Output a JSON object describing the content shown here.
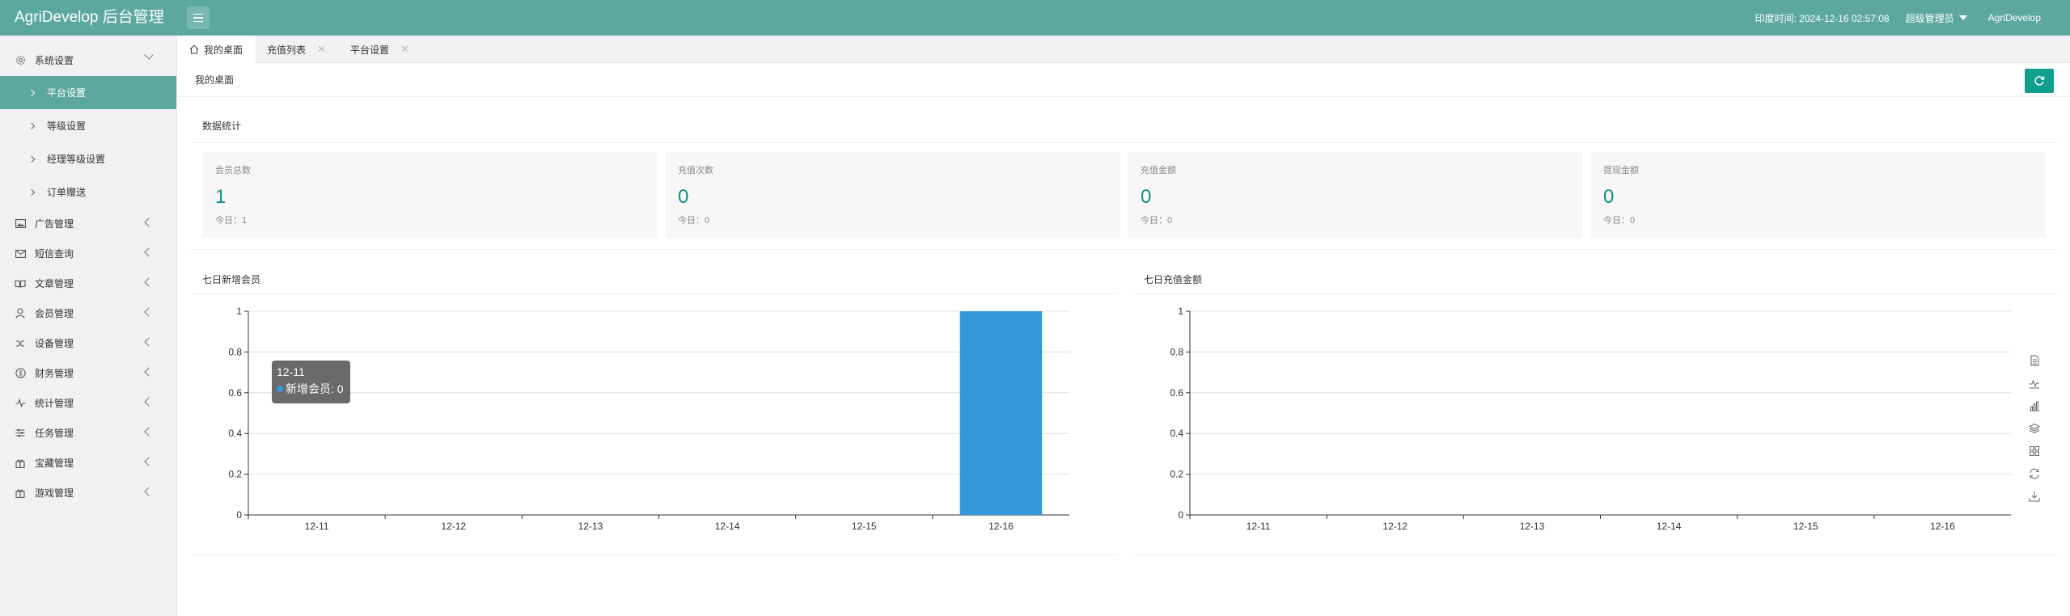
{
  "header": {
    "title": "AgriDevelop 后台管理",
    "time": "印度时间: 2024-12-16 02:57:08",
    "role": "超级管理员",
    "username": "AgriDevelop"
  },
  "sidebar": {
    "items": [
      {
        "label": "系统设置",
        "icon": "gear-icon",
        "expanded": true,
        "children": [
          {
            "label": "平台设置",
            "active": true
          },
          {
            "label": "等级设置"
          },
          {
            "label": "经理等级设置"
          },
          {
            "label": "订单赠送"
          }
        ]
      },
      {
        "label": "广告管理",
        "icon": "image-icon"
      },
      {
        "label": "短信查询",
        "icon": "mail-icon"
      },
      {
        "label": "文章管理",
        "icon": "book-icon"
      },
      {
        "label": "会员管理",
        "icon": "user-icon"
      },
      {
        "label": "设备管理",
        "icon": "shuffle-icon"
      },
      {
        "label": "财务管理",
        "icon": "dollar-icon"
      },
      {
        "label": "统计管理",
        "icon": "pulse-icon"
      },
      {
        "label": "任务管理",
        "icon": "sliders-icon"
      },
      {
        "label": "宝藏管理",
        "icon": "gift-icon"
      },
      {
        "label": "游戏管理",
        "icon": "gift-icon"
      }
    ]
  },
  "tabs": [
    {
      "label": "我的桌面",
      "active": true
    },
    {
      "label": "充值列表"
    },
    {
      "label": "平台设置"
    }
  ],
  "breadcrumb": "我的桌面",
  "stats": {
    "title": "数据统计",
    "cards": [
      {
        "title": "会员总数",
        "value": "1",
        "today": "今日：1"
      },
      {
        "title": "充值次数",
        "value": "0",
        "today": "今日：0"
      },
      {
        "title": "充值金额",
        "value": "0",
        "today": "今日：0"
      },
      {
        "title": "提现金额",
        "value": "0",
        "today": "今日：0"
      }
    ]
  },
  "chart_data": [
    {
      "type": "bar",
      "title": "七日新增会员",
      "categories": [
        "12-11",
        "12-12",
        "12-13",
        "12-14",
        "12-15",
        "12-16"
      ],
      "series": [
        {
          "name": "新增会员",
          "values": [
            0,
            0,
            0,
            0,
            0,
            1
          ]
        }
      ],
      "ylim": [
        0,
        1
      ],
      "yticks": [
        "0",
        "0.2",
        "0.4",
        "0.6",
        "0.8",
        "1"
      ],
      "grid": true,
      "color": "#3498db",
      "tooltip": {
        "title": "12-11",
        "series": "新增会员",
        "value": "0"
      }
    },
    {
      "type": "line",
      "title": "七日充值金额",
      "categories": [
        "12-11",
        "12-12",
        "12-13",
        "12-14",
        "12-15",
        "12-16"
      ],
      "series": [
        {
          "values": [
            0,
            0,
            0,
            0,
            0,
            0
          ]
        }
      ],
      "ylim": [
        0,
        1
      ],
      "yticks": [
        "0",
        "0.2",
        "0.4",
        "0.6",
        "0.8",
        "1"
      ],
      "grid": true,
      "toolbox": [
        "data-view-icon",
        "line-chart-icon",
        "bar-chart-icon",
        "stack-icon",
        "tiled-icon",
        "restore-icon",
        "download-icon"
      ]
    }
  ],
  "colors": {
    "header": "#5ca8a0",
    "accent": "#0f9f8c",
    "bar": "#3498db"
  }
}
